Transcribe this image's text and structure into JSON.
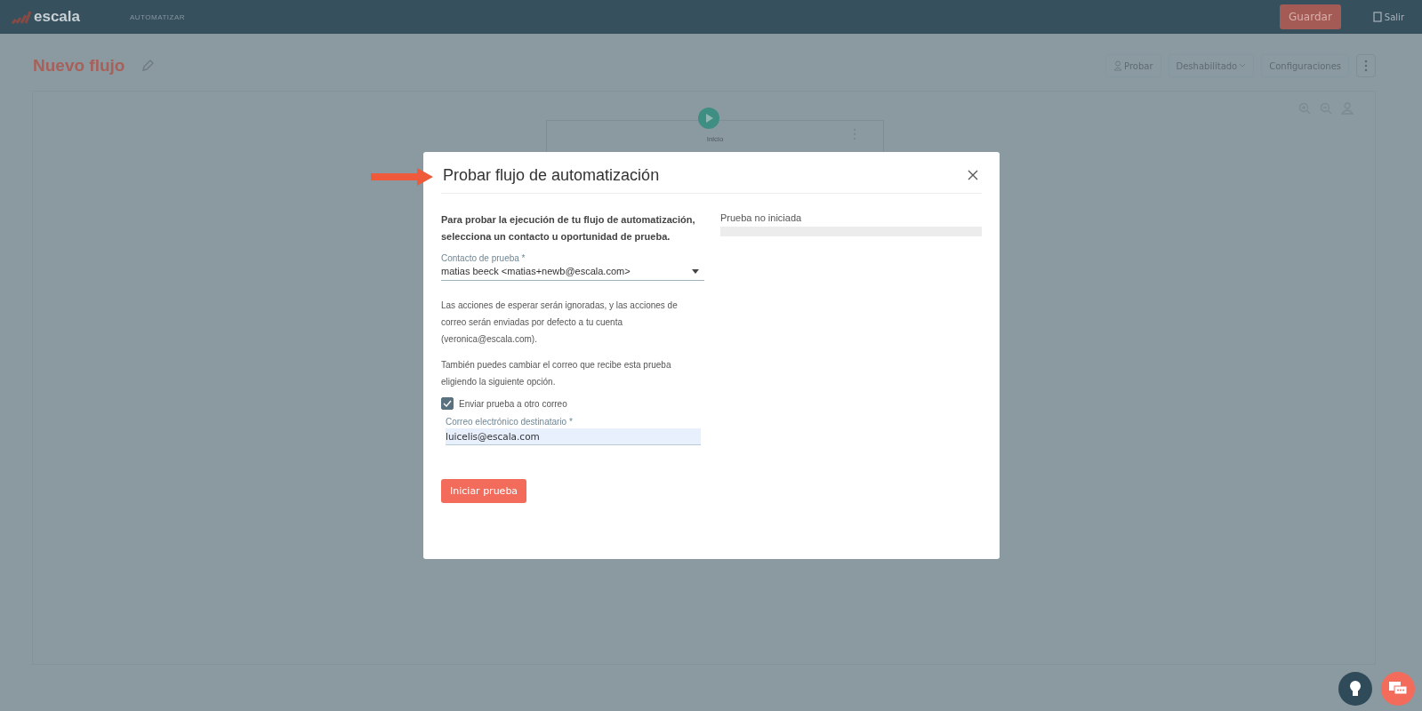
{
  "header": {
    "logo": "escala",
    "section": "AUTOMATIZAR",
    "save_button": "Guardar",
    "exit_button": "Salir"
  },
  "page": {
    "title": "Nuevo flujo",
    "actions": [
      {
        "kind": "test",
        "label": "Probar"
      },
      {
        "kind": "dropdown",
        "label": "Deshabilitado"
      },
      {
        "kind": "plain",
        "label": "Configuraciones"
      }
    ]
  },
  "canvas": {
    "start_node": "Inicio"
  },
  "modal": {
    "title": "Probar flujo de automatización",
    "intro": "Para probar la ejecución de tu flujo de automatización, selecciona un contacto u oportunidad de prueba.",
    "contact_field": {
      "label": "Contacto de prueba *",
      "value": "matias beeck <matias+newb@escala.com>"
    },
    "notes": [
      "Las acciones de esperar serán ignoradas, y las acciones de correo serán enviadas por defecto a tu cuenta (veronica@escala.com).",
      "También puedes cambiar el correo que recibe esta prueba eligiendo la siguiente opción."
    ],
    "checkbox": {
      "label": "Enviar prueba a otro correo",
      "checked": true
    },
    "email_field": {
      "label": "Correo electrónico destinatario *",
      "value": "luicelis@escala.com"
    },
    "start_button": "Iniciar prueba",
    "status": {
      "text": "Prueba no iniciada",
      "level": 0
    }
  }
}
